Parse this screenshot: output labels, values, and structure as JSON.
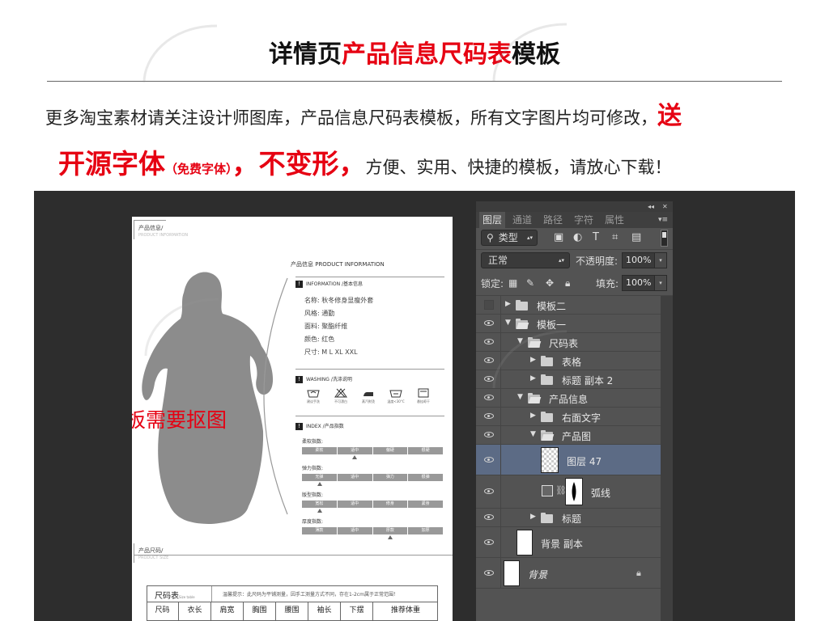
{
  "header": {
    "title_a": "详情页",
    "title_b": "产品信息尺码表",
    "title_c": "模板",
    "line1_text": "更多淘宝素材请关注设计师图库，产品信息尺码表模板，所有文字图片均可修改，",
    "line1_emph": "送",
    "line2_emph": "开源字体",
    "line2_small": "（免费字体）",
    "line2_emph2": "，不变形，",
    "line2_text": "方便、实用、快捷的模板，请放心下载！"
  },
  "colors": {
    "accent": "#e60012",
    "stage_bg": "#2d2d2d",
    "panel_bg": "#535353",
    "selected_row": "#5c6b85"
  },
  "doc": {
    "section1_label": "产品信息/",
    "section1_sub": "PRODUCT INFORMATION",
    "product_title": "产品信息 PRODUCT INFORMATION",
    "basic_header": "INFORMATION /基本信息",
    "basic_rows": [
      "名称:   秋冬修身显瘦外套",
      "风格:   通勤",
      "面料:   聚酯纤维",
      "颜色:   红色",
      "尺寸:   M L XL XXL"
    ],
    "wash_header": "WASHING /洗涤说明",
    "wash_items": [
      "建议手洗",
      "不可漂白",
      "蒸汽熨烫",
      "温度<30°C",
      "悬挂晾干"
    ],
    "index_header": "INDEX /产品指数",
    "indices": [
      {
        "label": "柔软指数:",
        "cells": [
          "柔软",
          "适中",
          "偏硬",
          "很硬"
        ],
        "marker": 1
      },
      {
        "label": "弹力指数:",
        "cells": [
          "无弹",
          "适中",
          "弹力",
          "很弹"
        ],
        "marker": 0
      },
      {
        "label": "版型指数:",
        "cells": [
          "宽松",
          "适中",
          "修身",
          "紧身"
        ],
        "marker": 0
      },
      {
        "label": "厚度指数:",
        "cells": [
          "薄款",
          "适中",
          "厚款",
          "加厚"
        ],
        "marker": 2
      }
    ],
    "cutout_note": "此模板需要抠图",
    "section2_label": "产品尺码/",
    "section2_sub": "PRODUCT SIZE",
    "size_title": "尺码表",
    "size_title_sub": "Size table",
    "size_tip": "温馨提示：此尺码为平铺测量，因手工测量方式不同，存在1-2cm属于正常范围！",
    "size_headers": [
      "尺码",
      "衣长",
      "肩宽",
      "胸围",
      "腰围",
      "袖长",
      "下摆",
      "推荐体重"
    ]
  },
  "ps": {
    "collapse_icon": "double-chevron-icon",
    "close_icon": "close-icon",
    "tabs": [
      "图层",
      "通道",
      "路径",
      "字符",
      "属性"
    ],
    "filter_label": "类型",
    "filter_icons": [
      "image-filter-icon",
      "adjustment-filter-icon",
      "type-filter-icon",
      "shape-filter-icon",
      "smart-object-filter-icon"
    ],
    "blend_mode": "正常",
    "opacity_label": "不透明度:",
    "opacity_value": "100%",
    "lock_label": "锁定:",
    "lock_icons": [
      "lock-transparent-icon",
      "lock-image-icon",
      "lock-position-icon",
      "lock-all-icon"
    ],
    "fill_label": "填充:",
    "fill_value": "100%",
    "layers": [
      {
        "name": "模板二",
        "type": "group",
        "indent": 0,
        "expanded": false,
        "visible": false
      },
      {
        "name": "模板一",
        "type": "group",
        "indent": 0,
        "expanded": true,
        "visible": true
      },
      {
        "name": "尺码表",
        "type": "group",
        "indent": 1,
        "expanded": true,
        "visible": true
      },
      {
        "name": "表格",
        "type": "group",
        "indent": 2,
        "expanded": false,
        "visible": true
      },
      {
        "name": "标题 副本 2",
        "type": "group",
        "indent": 2,
        "expanded": false,
        "visible": true
      },
      {
        "name": "产品信息",
        "type": "group",
        "indent": 1,
        "expanded": true,
        "visible": true
      },
      {
        "name": "右面文字",
        "type": "group",
        "indent": 2,
        "expanded": false,
        "visible": true
      },
      {
        "name": "产品图",
        "type": "group",
        "indent": 2,
        "expanded": true,
        "visible": true
      },
      {
        "name": "图层 47",
        "type": "layer",
        "indent": 3,
        "visible": true,
        "selected": true
      },
      {
        "name": "弧线",
        "type": "shape",
        "indent": 3,
        "visible": true
      },
      {
        "name": "标题",
        "type": "group",
        "indent": 2,
        "expanded": false,
        "visible": true
      },
      {
        "name": "背景 副本",
        "type": "layer",
        "indent": 0,
        "visible": true
      },
      {
        "name": "背景",
        "type": "background",
        "indent": 0,
        "visible": true,
        "locked": true
      }
    ]
  }
}
